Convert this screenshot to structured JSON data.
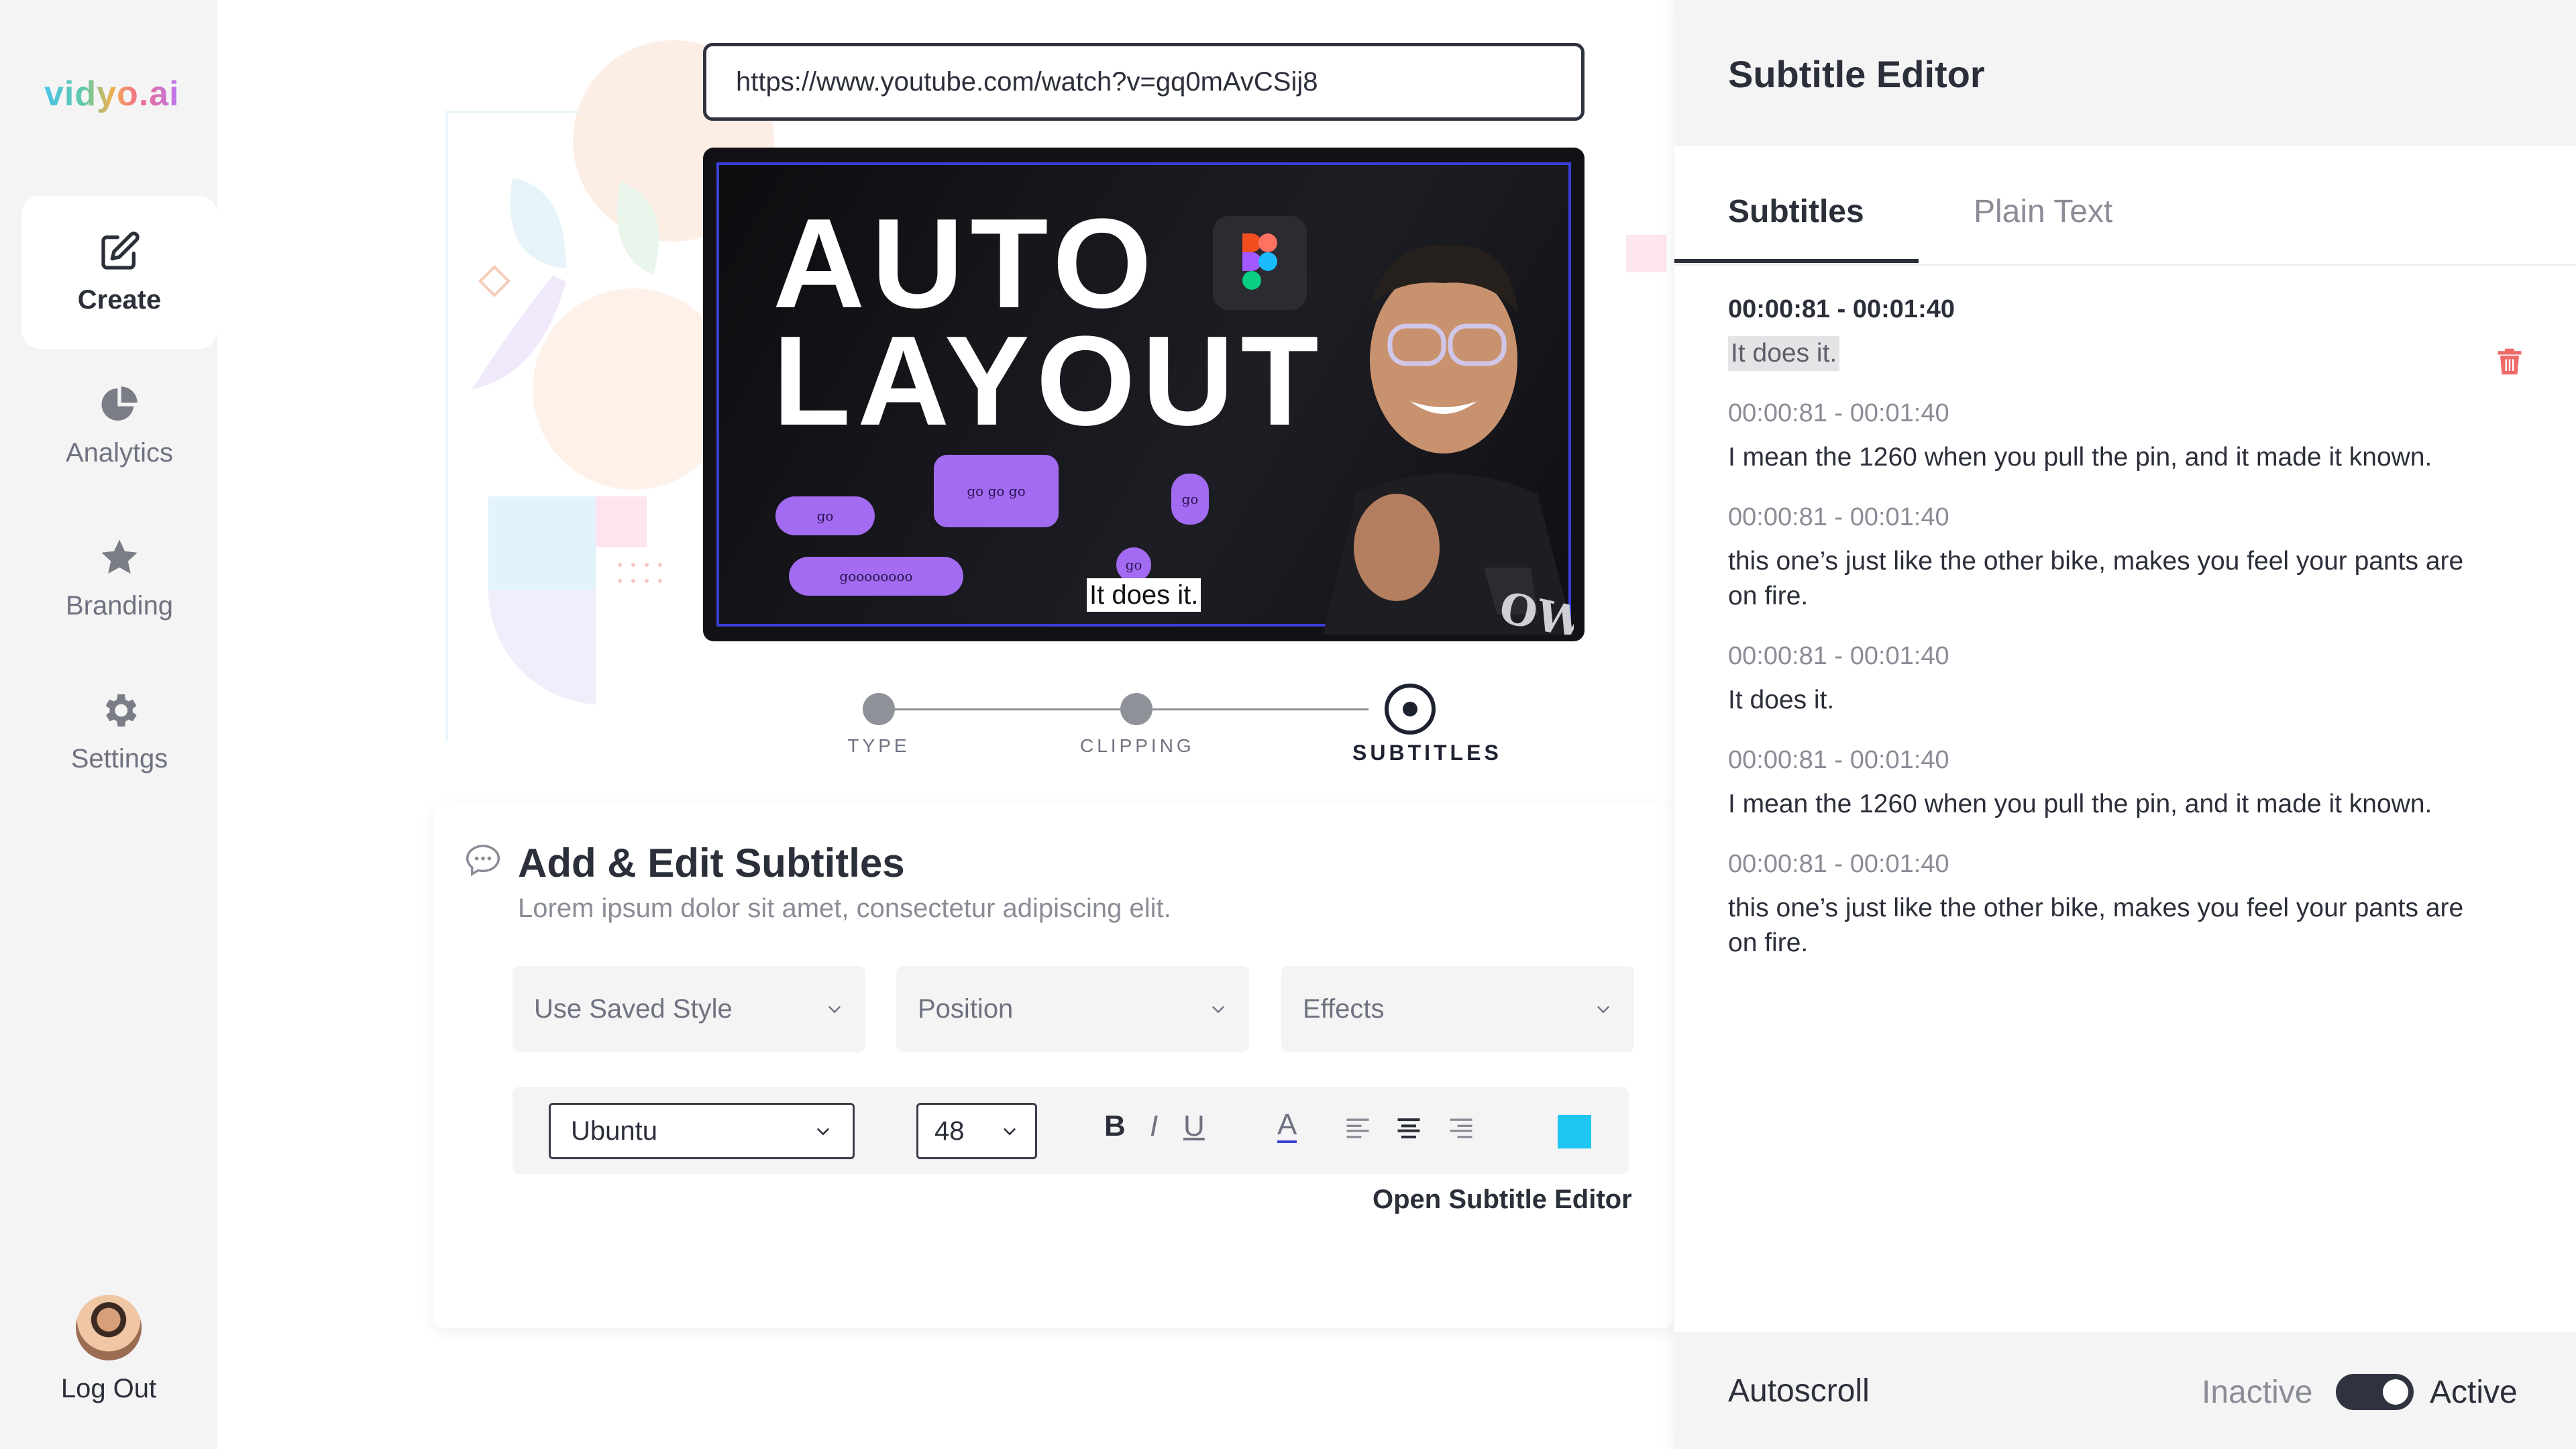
{
  "app": {
    "logo_text": "vidyo.ai",
    "logo_colors": [
      "#49c3e8",
      "#62c9a6",
      "#f2b04c",
      "#ef6d8f",
      "#b877f0"
    ]
  },
  "sidebar": {
    "items": [
      {
        "label": "Create",
        "icon": "edit-icon",
        "active": true
      },
      {
        "label": "Analytics",
        "icon": "pie-chart-icon",
        "active": false
      },
      {
        "label": "Branding",
        "icon": "star-icon",
        "active": false
      },
      {
        "label": "Settings",
        "icon": "gear-icon",
        "active": false
      }
    ],
    "logout_label": "Log Out"
  },
  "url_bar": {
    "value": "https://www.youtube.com/watch?v=gq0mAvCSij8"
  },
  "video": {
    "title_line1": "AUTO",
    "title_line2": "LAYOUT",
    "caption": "It does it.",
    "pills": [
      "go",
      "go go go",
      "go",
      "goooooooo",
      "go"
    ]
  },
  "steps": [
    {
      "label": "TYPE",
      "state": "done"
    },
    {
      "label": "CLIPPING",
      "state": "done"
    },
    {
      "label": "SUBTITLES",
      "state": "active"
    }
  ],
  "editor_card": {
    "title": "Add & Edit Subtitles",
    "subtitle": "Lorem ipsum dolor sit amet, consectetur adipiscing elit.",
    "dropdowns": [
      "Use Saved Style",
      "Position",
      "Effects"
    ],
    "font": "Ubuntu",
    "font_size": "48",
    "bold_label": "B",
    "italic_label": "I",
    "underline_label": "U",
    "text_color_label": "A",
    "swatch_color": "#1fc6f2",
    "open_editor_label": "Open Subtitle Editor"
  },
  "subtitle_panel": {
    "title": "Subtitle Editor",
    "tabs": [
      "Subtitles",
      "Plain Text"
    ],
    "active_tab": "Subtitles",
    "entries": [
      {
        "time": "00:00:81 - 00:01:40",
        "text": "It does it."
      },
      {
        "time": "00:00:81 - 00:01:40",
        "text": "I mean the 1260 when you pull the pin, and it made it known."
      },
      {
        "time": "00:00:81 - 00:01:40",
        "text": "this one’s just like the other bike, makes you feel your pants are on fire."
      },
      {
        "time": "00:00:81 - 00:01:40",
        "text": "It does it."
      },
      {
        "time": "00:00:81 - 00:01:40",
        "text": "I mean the 1260 when you pull the pin, and it made it known."
      },
      {
        "time": "00:00:81 - 00:01:40",
        "text": "this one’s just like the other bike, makes you feel your pants are on fire."
      }
    ],
    "footer": {
      "autoscroll_label": "Autoscroll",
      "inactive_label": "Inactive",
      "active_label": "Active",
      "toggle_state": "active"
    }
  }
}
